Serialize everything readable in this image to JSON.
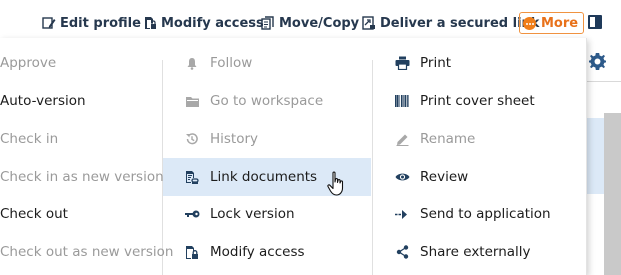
{
  "toolbar": {
    "items": [
      {
        "label": "Edit profile",
        "icon": "edit-profile-icon"
      },
      {
        "label": "Modify access",
        "icon": "modify-access-icon"
      },
      {
        "label": "Move/Copy",
        "icon": "move-copy-icon"
      },
      {
        "label": "Deliver a secured link",
        "icon": "secured-link-icon"
      }
    ],
    "more_label": "More",
    "colors": {
      "text": "#26384e",
      "more": "#e8711a"
    }
  },
  "menu": {
    "columns": [
      [
        {
          "label": "Approve",
          "enabled": false
        },
        {
          "label": "Auto-version",
          "enabled": true
        },
        {
          "label": "Check in",
          "enabled": false
        },
        {
          "label": "Check in as new version",
          "enabled": false
        },
        {
          "label": "Check out",
          "enabled": true
        },
        {
          "label": "Check out as new version",
          "enabled": false
        }
      ],
      [
        {
          "label": "Follow",
          "icon": "bell-icon",
          "enabled": false
        },
        {
          "label": "Go to workspace",
          "icon": "folder-icon",
          "enabled": false
        },
        {
          "label": "History",
          "icon": "history-icon",
          "enabled": false
        },
        {
          "label": "Link documents",
          "icon": "link-documents-icon",
          "enabled": true,
          "hovered": true
        },
        {
          "label": "Lock version",
          "icon": "key-icon",
          "enabled": true
        },
        {
          "label": "Modify access",
          "icon": "modify-access-icon",
          "enabled": true
        }
      ],
      [
        {
          "label": "Print",
          "icon": "printer-icon",
          "enabled": true
        },
        {
          "label": "Print cover sheet",
          "icon": "barcode-icon",
          "enabled": true
        },
        {
          "label": "Rename",
          "icon": "pencil-icon",
          "enabled": false
        },
        {
          "label": "Review",
          "icon": "eye-icon",
          "enabled": true
        },
        {
          "label": "Send to application",
          "icon": "send-icon",
          "enabled": true
        },
        {
          "label": "Share externally",
          "icon": "share-icon",
          "enabled": true
        }
      ]
    ],
    "colors": {
      "enabled": "#1c1c1c",
      "disabled": "#9a9a9a",
      "hover_bg": "#dce9f7"
    }
  }
}
